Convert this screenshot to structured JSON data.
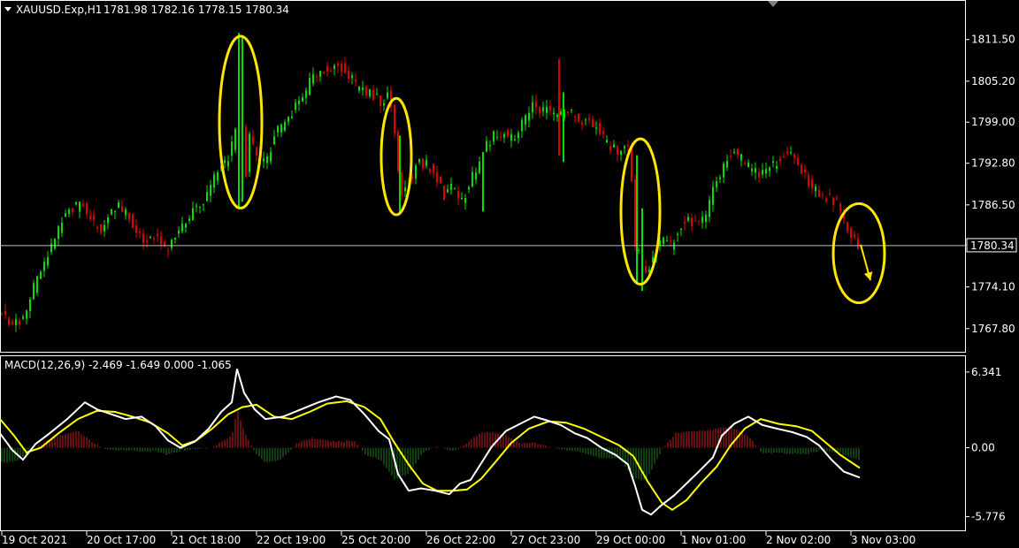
{
  "header": {
    "symbol": "XAUUSD.Exp,H1",
    "ohlc": "1781.98 1782.16 1778.15 1780.34"
  },
  "colors": {
    "background": "#000000",
    "frame": "#ffffff",
    "bull": "#00e000",
    "bear": "#e00000",
    "signal": "#ffff00",
    "macd": "#ffffff",
    "hist_pos": "#c81e1e",
    "hist_neg": "#1e7a1e",
    "highlight": "#ffe600"
  },
  "chart_data": [
    {
      "type": "candlestick",
      "symbol": "XAUUSD.Exp",
      "timeframe": "H1",
      "y_ticks": [
        1767.8,
        1774.1,
        1780.45,
        1786.5,
        1792.8,
        1799.0,
        1805.2,
        1811.5
      ],
      "y_tick_labels": [
        "1767.80",
        "1774.10",
        "",
        "1786.50",
        "1792.80",
        "1799.00",
        "1805.20",
        "1811.50"
      ],
      "ylim": [
        1765.1,
        1816.4
      ],
      "current_price": 1780.34,
      "current_price_label": "1780.34",
      "x_labels": [
        "19 Oct 2021",
        "20 Oct 17:00",
        "21 Oct 18:00",
        "22 Oct 19:00",
        "25 Oct 20:00",
        "26 Oct 22:00",
        "27 Oct 23:00",
        "29 Oct 00:00",
        "1 Nov 01:00",
        "2 Nov 02:00",
        "3 Nov 03:00"
      ],
      "close_path": [
        [
          0,
          1770.5
        ],
        [
          8,
          1769.0
        ],
        [
          18,
          1768.5
        ],
        [
          28,
          1769.5
        ],
        [
          38,
          1774.0
        ],
        [
          50,
          1777.5
        ],
        [
          62,
          1781.5
        ],
        [
          72,
          1784.5
        ],
        [
          82,
          1786.0
        ],
        [
          92,
          1786.5
        ],
        [
          102,
          1784.5
        ],
        [
          112,
          1782.5
        ],
        [
          122,
          1785.0
        ],
        [
          132,
          1786.5
        ],
        [
          142,
          1785.0
        ],
        [
          152,
          1783.5
        ],
        [
          162,
          1780.5
        ],
        [
          172,
          1782.5
        ],
        [
          182,
          1780.5
        ],
        [
          192,
          1780.0
        ],
        [
          202,
          1782.5
        ],
        [
          212,
          1784.5
        ],
        [
          222,
          1786.5
        ],
        [
          232,
          1787.0
        ],
        [
          242,
          1790.5
        ],
        [
          252,
          1792.5
        ],
        [
          260,
          1794.0
        ],
        [
          268,
          1800.0
        ],
        [
          272,
          1808.5
        ],
        [
          276,
          1788.5
        ],
        [
          282,
          1797.0
        ],
        [
          292,
          1792.5
        ],
        [
          302,
          1793.5
        ],
        [
          312,
          1797.5
        ],
        [
          322,
          1799.0
        ],
        [
          332,
          1801.0
        ],
        [
          342,
          1802.5
        ],
        [
          352,
          1805.5
        ],
        [
          362,
          1807.0
        ],
        [
          372,
          1806.5
        ],
        [
          382,
          1808.0
        ],
        [
          392,
          1806.5
        ],
        [
          402,
          1804.5
        ],
        [
          412,
          1803.5
        ],
        [
          422,
          1803.0
        ],
        [
          432,
          1802.0
        ],
        [
          440,
          1803.5
        ],
        [
          446,
          1797.5
        ],
        [
          452,
          1788.0
        ],
        [
          460,
          1789.5
        ],
        [
          472,
          1793.0
        ],
        [
          482,
          1792.5
        ],
        [
          492,
          1791.0
        ],
        [
          502,
          1788.0
        ],
        [
          512,
          1789.5
        ],
        [
          522,
          1787.0
        ],
        [
          532,
          1790.0
        ],
        [
          542,
          1793.5
        ],
        [
          552,
          1796.0
        ],
        [
          562,
          1797.5
        ],
        [
          572,
          1797.0
        ],
        [
          582,
          1796.5
        ],
        [
          592,
          1799.5
        ],
        [
          602,
          1801.5
        ],
        [
          612,
          1801.0
        ],
        [
          622,
          1800.5
        ],
        [
          632,
          1800.0
        ],
        [
          642,
          1801.0
        ],
        [
          652,
          1799.5
        ],
        [
          662,
          1799.0
        ],
        [
          672,
          1798.5
        ],
        [
          682,
          1796.5
        ],
        [
          692,
          1795.0
        ],
        [
          702,
          1794.5
        ],
        [
          712,
          1795.5
        ],
        [
          718,
          1780.0
        ],
        [
          724,
          1778.5
        ],
        [
          730,
          1776.0
        ],
        [
          738,
          1779.0
        ],
        [
          748,
          1781.0
        ],
        [
          758,
          1780.5
        ],
        [
          768,
          1783.0
        ],
        [
          778,
          1784.0
        ],
        [
          788,
          1783.5
        ],
        [
          798,
          1784.5
        ],
        [
          808,
          1789.5
        ],
        [
          818,
          1792.5
        ],
        [
          828,
          1794.5
        ],
        [
          838,
          1793.5
        ],
        [
          848,
          1792.0
        ],
        [
          858,
          1791.0
        ],
        [
          868,
          1792.0
        ],
        [
          878,
          1793.0
        ],
        [
          888,
          1794.0
        ],
        [
          898,
          1793.5
        ],
        [
          908,
          1791.5
        ],
        [
          918,
          1789.0
        ],
        [
          928,
          1788.0
        ],
        [
          938,
          1787.5
        ],
        [
          946,
          1787.0
        ],
        [
          952,
          1784.5
        ],
        [
          960,
          1781.5
        ],
        [
          966,
          1781.0
        ],
        [
          972,
          1780.3
        ]
      ],
      "spikes": [
        {
          "at": 270,
          "high": 1812.5,
          "low": 1786.0,
          "color": "bull"
        },
        {
          "at": 274,
          "high": 1812.0,
          "low": 1787.0,
          "color": "bull"
        },
        {
          "at": 452,
          "high": 1797.0,
          "low": 1785.0,
          "color": "bull"
        },
        {
          "at": 546,
          "high": 1794.5,
          "low": 1785.5,
          "color": "bull"
        },
        {
          "at": 632,
          "high": 1808.5,
          "low": 1794.0,
          "color": "bear"
        },
        {
          "at": 637,
          "high": 1803.5,
          "low": 1793.0,
          "color": "bull"
        },
        {
          "at": 720,
          "high": 1794.0,
          "low": 1774.5,
          "color": "bull"
        },
        {
          "at": 726,
          "high": 1786.0,
          "low": 1773.5,
          "color": "bull"
        }
      ],
      "annotations": [
        {
          "type": "ellipse",
          "cx": 272,
          "cy": 1799.0,
          "rx": 24,
          "ry": 13.0
        },
        {
          "type": "ellipse",
          "cx": 448,
          "cy": 1793.8,
          "rx": 17,
          "ry": 8.8
        },
        {
          "type": "ellipse",
          "cx": 724,
          "cy": 1785.5,
          "rx": 22,
          "ry": 11.0
        },
        {
          "type": "ellipse",
          "cx": 971,
          "cy": 1779.2,
          "rx": 29,
          "ry": 7.5
        },
        {
          "type": "arrow",
          "from": [
            973,
            1780.5
          ],
          "to": [
            984,
            1775.1
          ]
        }
      ]
    },
    {
      "type": "macd",
      "title": "MACD(12,26,9) -2.469 -1.649 0.000 -1.065",
      "params": [
        12,
        26,
        9
      ],
      "values": {
        "macd": -2.469,
        "signal": -1.649,
        "level": 0.0,
        "histogram": -1.065
      },
      "y_ticks": [
        6.341,
        0.0,
        -5.776
      ],
      "y_tick_labels": [
        "6.341",
        "0.00",
        "-5.776"
      ],
      "ylim": [
        -6.4,
        7.0
      ],
      "macd_path": [
        [
          0,
          1.2
        ],
        [
          14,
          -0.2
        ],
        [
          26,
          -1.0
        ],
        [
          40,
          0.3
        ],
        [
          56,
          1.2
        ],
        [
          76,
          2.4
        ],
        [
          96,
          3.8
        ],
        [
          110,
          3.2
        ],
        [
          126,
          2.8
        ],
        [
          142,
          2.4
        ],
        [
          160,
          2.6
        ],
        [
          176,
          1.8
        ],
        [
          190,
          0.6
        ],
        [
          204,
          0.0
        ],
        [
          220,
          0.5
        ],
        [
          236,
          1.6
        ],
        [
          250,
          3.0
        ],
        [
          262,
          3.8
        ],
        [
          268,
          6.6
        ],
        [
          276,
          4.6
        ],
        [
          288,
          3.2
        ],
        [
          300,
          2.4
        ],
        [
          320,
          2.6
        ],
        [
          340,
          3.2
        ],
        [
          360,
          3.8
        ],
        [
          380,
          4.3
        ],
        [
          396,
          4.0
        ],
        [
          412,
          2.8
        ],
        [
          428,
          1.4
        ],
        [
          440,
          0.7
        ],
        [
          450,
          -2.2
        ],
        [
          462,
          -3.6
        ],
        [
          476,
          -3.4
        ],
        [
          492,
          -3.6
        ],
        [
          508,
          -3.9
        ],
        [
          520,
          -3.0
        ],
        [
          532,
          -2.7
        ],
        [
          544,
          -1.3
        ],
        [
          556,
          0.1
        ],
        [
          572,
          1.4
        ],
        [
          588,
          2.0
        ],
        [
          604,
          2.6
        ],
        [
          618,
          2.3
        ],
        [
          634,
          1.9
        ],
        [
          650,
          1.2
        ],
        [
          664,
          0.8
        ],
        [
          680,
          0.0
        ],
        [
          696,
          -0.6
        ],
        [
          710,
          -1.4
        ],
        [
          718,
          -3.2
        ],
        [
          726,
          -5.2
        ],
        [
          736,
          -5.6
        ],
        [
          748,
          -4.8
        ],
        [
          762,
          -4.0
        ],
        [
          776,
          -3.0
        ],
        [
          790,
          -2.0
        ],
        [
          806,
          -0.8
        ],
        [
          816,
          1.0
        ],
        [
          830,
          2.0
        ],
        [
          846,
          2.6
        ],
        [
          862,
          1.9
        ],
        [
          878,
          1.6
        ],
        [
          896,
          1.3
        ],
        [
          912,
          0.9
        ],
        [
          926,
          0.2
        ],
        [
          940,
          -1.0
        ],
        [
          954,
          -2.0
        ],
        [
          972,
          -2.5
        ]
      ],
      "signal_path": [
        [
          0,
          2.4
        ],
        [
          16,
          1.0
        ],
        [
          30,
          -0.4
        ],
        [
          46,
          0.0
        ],
        [
          66,
          1.2
        ],
        [
          88,
          2.4
        ],
        [
          110,
          3.1
        ],
        [
          130,
          3.0
        ],
        [
          150,
          2.6
        ],
        [
          170,
          2.1
        ],
        [
          190,
          1.2
        ],
        [
          206,
          0.2
        ],
        [
          222,
          0.6
        ],
        [
          240,
          1.6
        ],
        [
          258,
          2.8
        ],
        [
          274,
          3.4
        ],
        [
          290,
          3.6
        ],
        [
          310,
          2.6
        ],
        [
          330,
          2.4
        ],
        [
          350,
          3.0
        ],
        [
          370,
          3.7
        ],
        [
          392,
          3.9
        ],
        [
          412,
          3.4
        ],
        [
          430,
          2.4
        ],
        [
          446,
          0.4
        ],
        [
          462,
          -1.4
        ],
        [
          478,
          -3.0
        ],
        [
          494,
          -3.6
        ],
        [
          512,
          -3.6
        ],
        [
          528,
          -3.5
        ],
        [
          544,
          -2.6
        ],
        [
          560,
          -1.2
        ],
        [
          578,
          0.4
        ],
        [
          598,
          1.6
        ],
        [
          620,
          2.2
        ],
        [
          640,
          2.1
        ],
        [
          660,
          1.6
        ],
        [
          680,
          0.9
        ],
        [
          700,
          0.2
        ],
        [
          716,
          -0.7
        ],
        [
          732,
          -2.8
        ],
        [
          748,
          -4.6
        ],
        [
          760,
          -5.2
        ],
        [
          776,
          -4.4
        ],
        [
          792,
          -3.0
        ],
        [
          810,
          -1.6
        ],
        [
          826,
          0.2
        ],
        [
          842,
          1.6
        ],
        [
          860,
          2.4
        ],
        [
          880,
          2.0
        ],
        [
          900,
          1.8
        ],
        [
          918,
          1.4
        ],
        [
          934,
          0.4
        ],
        [
          950,
          -0.6
        ],
        [
          972,
          -1.7
        ]
      ],
      "histogram_path": [
        [
          0,
          -1.2
        ],
        [
          16,
          -1.2
        ],
        [
          30,
          -0.6
        ],
        [
          46,
          0.3
        ],
        [
          66,
          1.0
        ],
        [
          88,
          1.4
        ],
        [
          104,
          0.5
        ],
        [
          120,
          -0.2
        ],
        [
          140,
          -0.2
        ],
        [
          160,
          -0.3
        ],
        [
          176,
          -0.3
        ],
        [
          190,
          -0.6
        ],
        [
          206,
          -0.2
        ],
        [
          222,
          -0.1
        ],
        [
          240,
          0.0
        ],
        [
          252,
          0.6
        ],
        [
          262,
          1.0
        ],
        [
          268,
          3.2
        ],
        [
          276,
          1.4
        ],
        [
          288,
          -0.4
        ],
        [
          300,
          -1.2
        ],
        [
          318,
          -1.0
        ],
        [
          336,
          0.4
        ],
        [
          352,
          0.8
        ],
        [
          368,
          0.6
        ],
        [
          384,
          0.5
        ],
        [
          400,
          0.6
        ],
        [
          414,
          -0.6
        ],
        [
          430,
          -1.0
        ],
        [
          446,
          -2.6
        ],
        [
          462,
          -2.2
        ],
        [
          478,
          -0.4
        ],
        [
          494,
          0.1
        ],
        [
          512,
          -0.3
        ],
        [
          528,
          0.4
        ],
        [
          544,
          1.3
        ],
        [
          556,
          1.3
        ],
        [
          572,
          1.0
        ],
        [
          588,
          0.4
        ],
        [
          604,
          0.4
        ],
        [
          620,
          0.1
        ],
        [
          640,
          -0.2
        ],
        [
          660,
          -0.4
        ],
        [
          680,
          -0.9
        ],
        [
          700,
          -0.8
        ],
        [
          716,
          -2.5
        ],
        [
          730,
          -2.8
        ],
        [
          748,
          -0.2
        ],
        [
          764,
          1.2
        ],
        [
          780,
          1.4
        ],
        [
          796,
          1.4
        ],
        [
          812,
          1.6
        ],
        [
          826,
          1.8
        ],
        [
          846,
          1.0
        ],
        [
          862,
          -0.5
        ],
        [
          878,
          -0.4
        ],
        [
          896,
          -0.5
        ],
        [
          912,
          -0.5
        ],
        [
          930,
          -0.2
        ],
        [
          948,
          -0.4
        ],
        [
          960,
          -0.8
        ],
        [
          972,
          -1.0
        ]
      ]
    }
  ]
}
